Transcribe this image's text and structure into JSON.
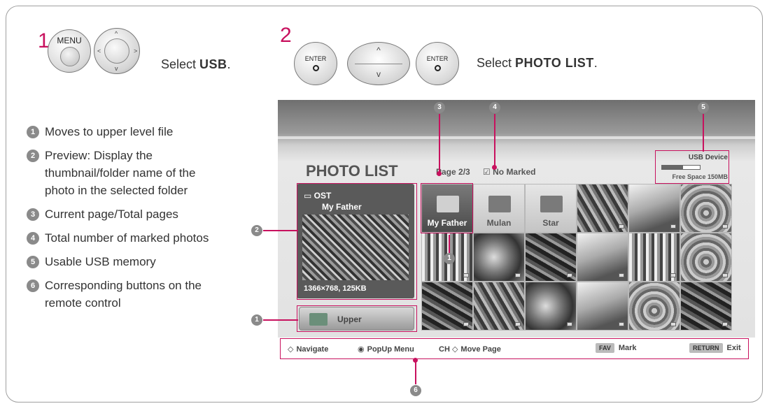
{
  "steps": [
    {
      "number": "1",
      "instruction_prefix": "Select ",
      "instruction_bold": "USB",
      "instruction_suffix": "."
    },
    {
      "number": "2",
      "instruction_prefix": "Select ",
      "instruction_bold": "PHOTO LIST",
      "instruction_suffix": "."
    }
  ],
  "remote": {
    "menu_label": "MENU",
    "enter_label": "ENTER",
    "arrow_up": "^",
    "arrow_down": "v",
    "arrow_left": "<",
    "arrow_right": ">"
  },
  "legend": [
    {
      "num": "1",
      "text": "Moves to upper level file"
    },
    {
      "num": "2",
      "text": "Preview: Display the thumbnail/folder name of the photo in the selected folder"
    },
    {
      "num": "3",
      "text": "Current page/Total pages"
    },
    {
      "num": "4",
      "text": "Total number of marked photos"
    },
    {
      "num": "5",
      "text": "Usable USB memory"
    },
    {
      "num": "6",
      "text": "Corresponding buttons on the remote control"
    }
  ],
  "callouts": {
    "c1": "1",
    "c2": "2",
    "c3": "3",
    "c4": "4",
    "c5": "5",
    "c6": "6",
    "grid_c1": "1"
  },
  "screen": {
    "title": "PHOTO LIST",
    "page_info": "Page 2/3",
    "marked_icon": "☑",
    "marked_info": "No Marked",
    "usb": {
      "label": "USB Device",
      "usage_fraction": 0.55,
      "free_space": "Free Space 150MB"
    },
    "preview": {
      "folder": "OST",
      "name": "My Father",
      "info": "1366×768, 125KB"
    },
    "upper_label": "Upper",
    "folders": [
      {
        "label": "My Father",
        "selected": true
      },
      {
        "label": "Mulan",
        "selected": false
      },
      {
        "label": "Star",
        "selected": false
      }
    ]
  },
  "navbar": {
    "navigate_glyph": "◇",
    "navigate": "Navigate",
    "popup_glyph": "◉",
    "popup": "PopUp Menu",
    "ch": "CH",
    "ch_glyph": "◇",
    "move_page": "Move Page",
    "fav_key": "FAV",
    "mark": "Mark",
    "return_key": "RETURN",
    "exit": "Exit"
  },
  "colors": {
    "accent": "#c8115e",
    "callout": "#8a8a8a"
  }
}
